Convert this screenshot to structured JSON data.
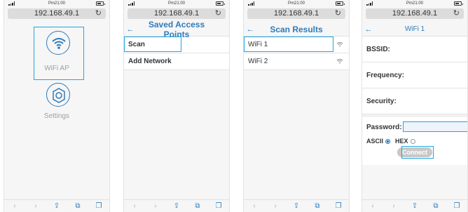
{
  "status": {
    "time": "Pm21:00"
  },
  "url": "192.168.49.1",
  "reload_glyph": "↻",
  "screens": {
    "home": {
      "items": [
        {
          "label": "WiFi AP",
          "icon": "wifi-icon"
        },
        {
          "label": "Settings",
          "icon": "gear-icon"
        }
      ]
    },
    "saved": {
      "back": "←",
      "title": "Saved Access Points",
      "rows": [
        "Scan",
        "Add Network"
      ]
    },
    "scan": {
      "back": "←",
      "title": "Scan Results",
      "rows": [
        "WiFi 1",
        "WiFi 2"
      ]
    },
    "detail": {
      "back": "←",
      "title": "WiFi 1",
      "fields": [
        "BSSID:",
        "Frequency:",
        "Security:"
      ],
      "password_label": "Password:",
      "ascii_label": "ASCII",
      "hex_label": "HEX",
      "connect_label": "Connect"
    }
  },
  "toolbar": {
    "back": "‹",
    "forward": "›",
    "share": "⇪",
    "bookmarks": "⧉",
    "tabs": "❐"
  },
  "colors": {
    "accent": "#2e7bbb",
    "highlight": "#1fa7e0"
  }
}
